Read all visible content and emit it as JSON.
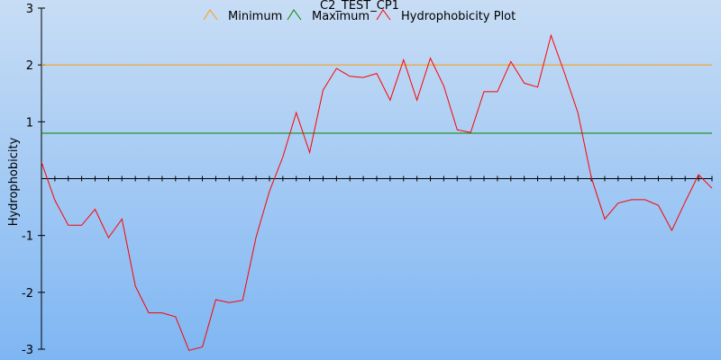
{
  "chart_data": {
    "type": "line",
    "title": "C2_TEST_CP1",
    "xlabel": "",
    "ylabel": "Hydrophobicity",
    "ylim": [
      -3,
      3
    ],
    "yticks": [
      "3",
      "2",
      "1",
      "-1",
      "-2",
      "-3"
    ],
    "grid": false,
    "legend_placement": "top",
    "x": [
      0,
      1,
      2,
      3,
      4,
      5,
      6,
      7,
      8,
      9,
      10,
      11,
      12,
      13,
      14,
      15,
      16,
      17,
      18,
      19,
      20,
      21,
      22,
      23,
      24,
      25,
      26,
      27,
      28,
      29,
      30,
      31,
      32,
      33,
      34,
      35,
      36,
      37,
      38,
      39,
      40,
      41,
      42,
      43,
      44,
      45,
      46,
      47
    ],
    "series": [
      {
        "name": "Minimum",
        "type": "threshold",
        "color": "#ff9900",
        "value": 2.0
      },
      {
        "name": "Maximum",
        "type": "threshold",
        "color": "#008800",
        "value": 0.8
      },
      {
        "name": "Hydrophobicity Plot",
        "type": "line",
        "color": "#ff0000",
        "values": [
          0.29,
          -0.38,
          -0.82,
          -0.82,
          -0.54,
          -1.04,
          -0.71,
          -1.89,
          -2.36,
          -2.36,
          -2.43,
          -3.02,
          -2.96,
          -2.13,
          -2.18,
          -2.14,
          -1.03,
          -0.22,
          0.38,
          1.16,
          0.46,
          1.56,
          1.94,
          1.8,
          1.78,
          1.85,
          1.38,
          2.09,
          1.38,
          2.12,
          1.63,
          0.86,
          0.81,
          1.53,
          1.53,
          2.06,
          1.68,
          1.61,
          2.52,
          1.86,
          1.16,
          0.02,
          -0.71,
          -0.43,
          -0.37,
          -0.37,
          -0.47,
          -0.91,
          -0.41,
          0.07,
          -0.17
        ]
      }
    ]
  }
}
